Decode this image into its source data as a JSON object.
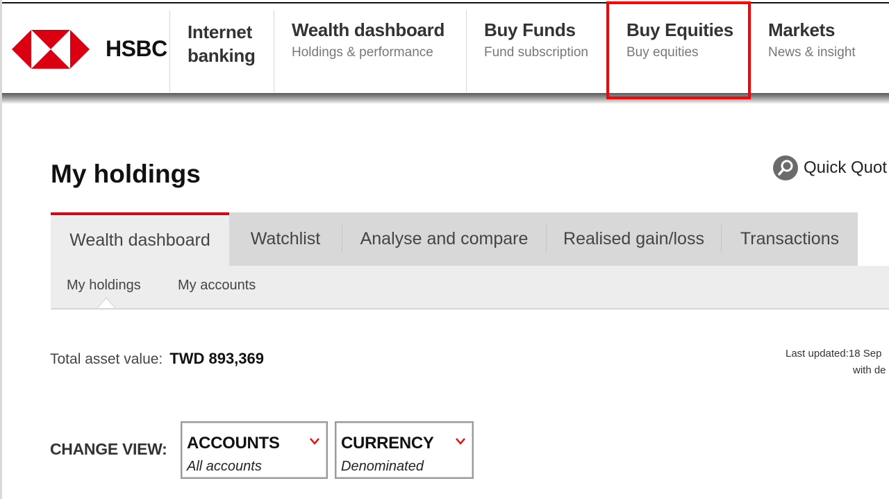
{
  "header": {
    "logo_text": "HSBC",
    "nav": [
      {
        "title_line1": "Internet",
        "title_line2": "banking"
      },
      {
        "title": "Wealth dashboard",
        "subtitle": "Holdings & performance"
      },
      {
        "title": "Buy Funds",
        "subtitle": "Fund subscription"
      },
      {
        "title": "Buy Equities",
        "subtitle": "Buy equities",
        "highlighted": true
      },
      {
        "title": "Markets",
        "subtitle": "News & insight"
      }
    ],
    "highlight_color": "#ff0000"
  },
  "page": {
    "title": "My holdings",
    "quick_quote": "Quick Quot"
  },
  "tabs": [
    {
      "label": "Wealth dashboard",
      "active": true
    },
    {
      "label": "Watchlist"
    },
    {
      "label": "Analyse and compare"
    },
    {
      "label": "Realised gain/loss"
    },
    {
      "label": "Transactions"
    }
  ],
  "subtabs": [
    {
      "label": "My holdings",
      "active": true
    },
    {
      "label": "My accounts"
    }
  ],
  "summary": {
    "total_label": "Total asset value:",
    "total_value": "TWD 893,369",
    "last_updated_line1": "Last updated:18 Sep",
    "last_updated_line2": "with de"
  },
  "change_view": {
    "label": "CHANGE VIEW:",
    "accounts": {
      "title": "ACCOUNTS",
      "value": "All accounts"
    },
    "currency": {
      "title": "CURRENCY",
      "value": "Denominated"
    }
  },
  "colors": {
    "brand_red": "#db0011",
    "tab_bg": "#d8d8d8",
    "active_tab_bg": "#ededed"
  }
}
